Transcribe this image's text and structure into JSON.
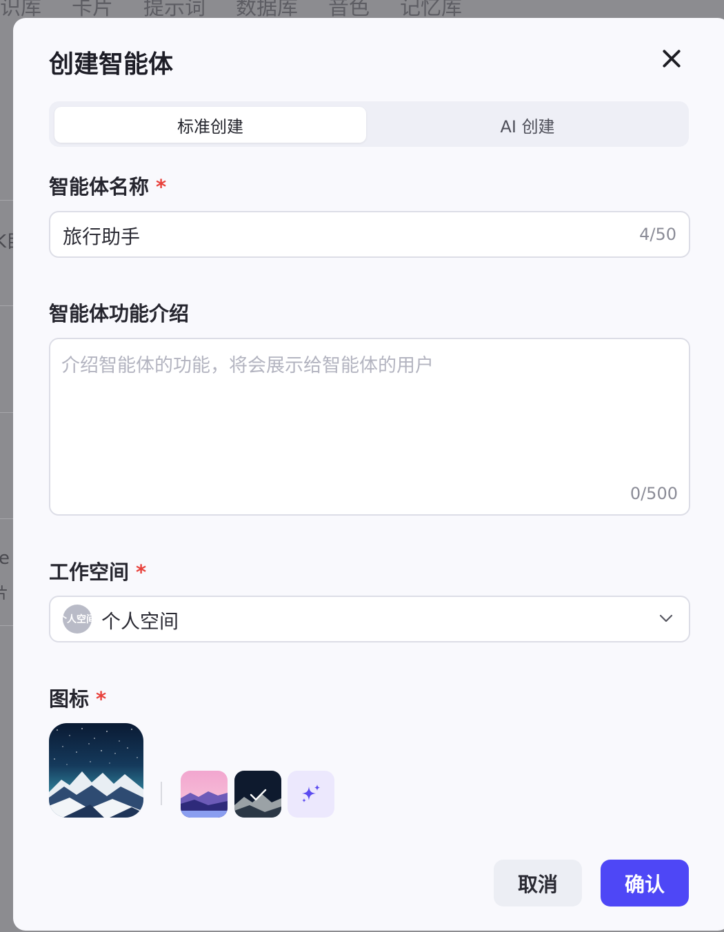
{
  "background": {
    "tabs": [
      "识库",
      "卡片",
      "提示词",
      "数据库",
      "音色",
      "记忆库"
    ],
    "cut_texts": [
      "K目",
      "e",
      "片"
    ]
  },
  "modal": {
    "title": "创建智能体",
    "mode_tabs": [
      {
        "label": "标准创建",
        "active": true
      },
      {
        "label": "AI 创建",
        "active": false
      }
    ],
    "name_field": {
      "label": "智能体名称",
      "required_mark": "*",
      "value": "旅行助手",
      "counter": "4/50"
    },
    "desc_field": {
      "label": "智能体功能介绍",
      "placeholder": "介绍智能体的功能，将会展示给智能体的用户",
      "value": "",
      "counter": "0/500"
    },
    "workspace_field": {
      "label": "工作空间",
      "required_mark": "*",
      "avatar_text": "个人空间",
      "value": "个人空间",
      "icon": "chevron-down-icon"
    },
    "icon_field": {
      "label": "图标",
      "required_mark": "*",
      "magic_icon": "sparkle-icon"
    },
    "buttons": {
      "cancel": "取消",
      "confirm": "确认"
    }
  },
  "colors": {
    "primary": "#4e47f6",
    "required": "#e8413b",
    "backdrop": "#8c8c90"
  }
}
